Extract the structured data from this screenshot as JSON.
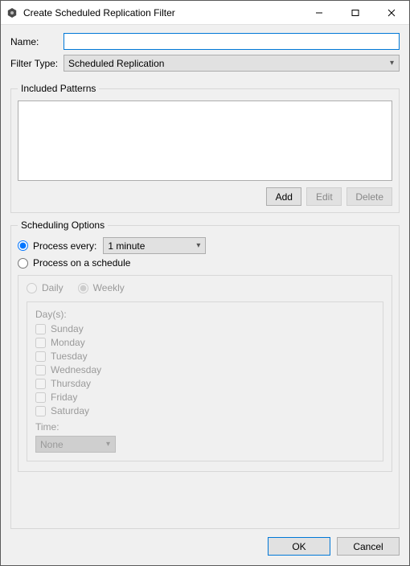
{
  "window": {
    "title": "Create Scheduled Replication Filter"
  },
  "form": {
    "name_label": "Name:",
    "name_value": "",
    "filter_type_label": "Filter Type:",
    "filter_type_value": "Scheduled Replication"
  },
  "patterns": {
    "legend": "Included Patterns",
    "add": "Add",
    "edit": "Edit",
    "delete": "Delete"
  },
  "scheduling": {
    "legend": "Scheduling Options",
    "process_every_label": "Process every:",
    "process_every_value": "1 minute",
    "process_schedule_label": "Process on a schedule",
    "daily": "Daily",
    "weekly": "Weekly",
    "days_label": "Day(s):",
    "days": [
      "Sunday",
      "Monday",
      "Tuesday",
      "Wednesday",
      "Thursday",
      "Friday",
      "Saturday"
    ],
    "time_label": "Time:",
    "time_value": "None"
  },
  "buttons": {
    "ok": "OK",
    "cancel": "Cancel"
  }
}
